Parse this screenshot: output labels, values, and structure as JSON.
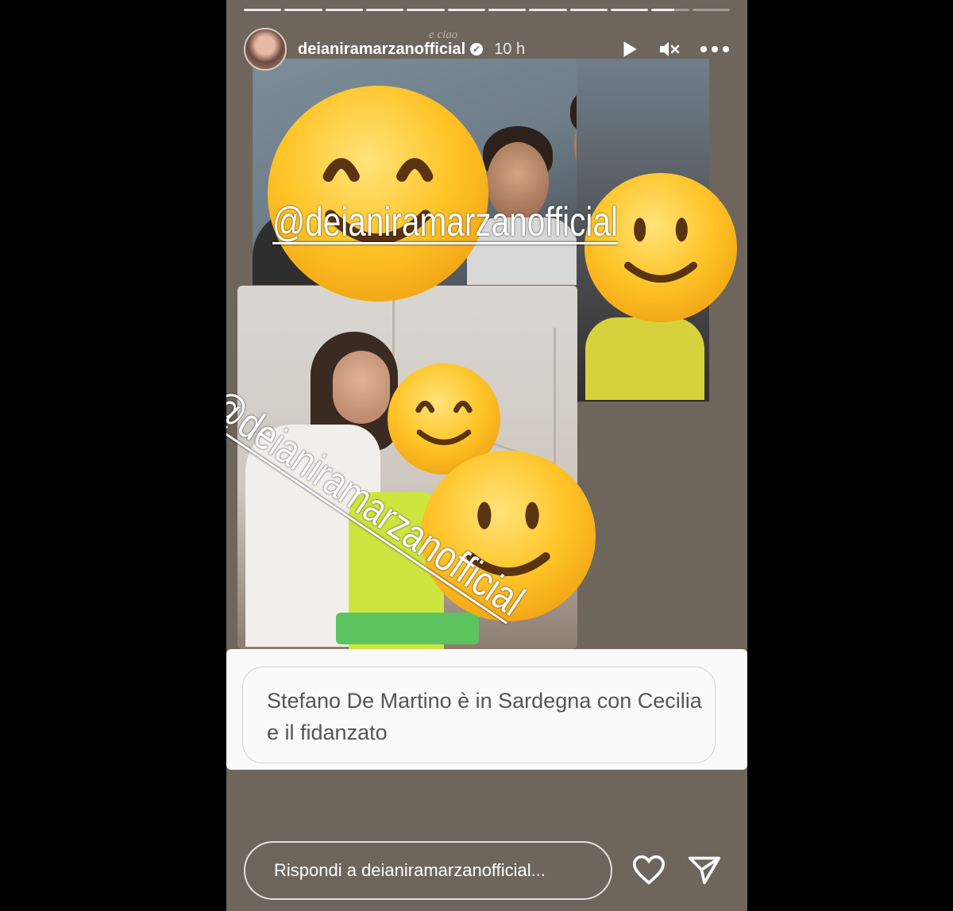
{
  "story": {
    "segments": 12,
    "username": "deianiramarzanofficial",
    "time": "10 h",
    "overlay_small_text": "e ciao",
    "mention_1": "@deianiramarzanofficial",
    "mention_2": "@deianiramarzanofficial",
    "caption": "Stefano De Martino è in Sardegna con Cecilia e il fidanzato",
    "reply_placeholder": "Rispondi a deianiramarzanofficial..."
  },
  "icons": {
    "play": "play-icon",
    "mute": "muted-speaker-icon",
    "more": "more-icon",
    "like": "heart-icon",
    "send": "send-icon",
    "verified": "verified-badge-icon"
  },
  "colors": {
    "story_bg": "#6e665d",
    "emoji_yellow": "#ffc529",
    "neon_shirt": "#cde53f"
  }
}
